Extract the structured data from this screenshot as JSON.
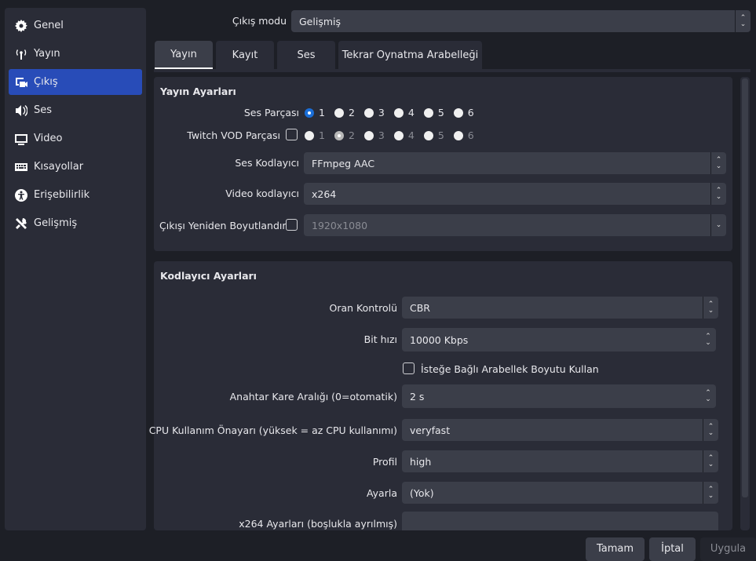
{
  "sidebar": {
    "items": [
      {
        "label": "Genel",
        "icon": "gear-icon"
      },
      {
        "label": "Yayın",
        "icon": "antenna-icon"
      },
      {
        "label": "Çıkış",
        "icon": "output-icon",
        "active": true
      },
      {
        "label": "Ses",
        "icon": "speaker-icon"
      },
      {
        "label": "Video",
        "icon": "monitor-icon"
      },
      {
        "label": "Kısayollar",
        "icon": "keyboard-icon"
      },
      {
        "label": "Erişebilirlik",
        "icon": "accessibility-icon"
      },
      {
        "label": "Gelişmiş",
        "icon": "tools-icon"
      }
    ]
  },
  "output_mode": {
    "label": "Çıkış modu",
    "value": "Gelişmiş"
  },
  "tabs": [
    {
      "label": "Yayın",
      "active": true
    },
    {
      "label": "Kayıt"
    },
    {
      "label": "Ses"
    },
    {
      "label": "Tekrar Oynatma Arabelleği"
    }
  ],
  "stream": {
    "title": "Yayın Ayarları",
    "audio_track": {
      "label": "Ses Parçası",
      "options": [
        "1",
        "2",
        "3",
        "4",
        "5",
        "6"
      ],
      "selected": "1"
    },
    "vod_track": {
      "label": "Twitch VOD Parçası",
      "checked": false,
      "options": [
        "1",
        "2",
        "3",
        "4",
        "5",
        "6"
      ],
      "selected": "2"
    },
    "audio_encoder": {
      "label": "Ses Kodlayıcı",
      "value": "FFmpeg AAC"
    },
    "video_encoder": {
      "label": "Video kodlayıcı",
      "value": "x264"
    },
    "rescale": {
      "label": "Çıkışı Yeniden Boyutlandır",
      "checked": false,
      "value": "1920x1080"
    }
  },
  "encoder": {
    "title": "Kodlayıcı Ayarları",
    "rate_control": {
      "label": "Oran Kontrolü",
      "value": "CBR"
    },
    "bitrate": {
      "label": "Bit hızı",
      "value": "10000 Kbps"
    },
    "custom_buffer": {
      "label": "İsteğe Bağlı Arabellek Boyutu Kullan",
      "checked": false
    },
    "keyframe": {
      "label": "Anahtar Kare Aralığı (0=otomatik)",
      "value": "2 s"
    },
    "preset": {
      "label": "CPU Kullanım Önayarı (yüksek = az CPU kullanımı)",
      "value": "veryfast"
    },
    "profile": {
      "label": "Profil",
      "value": "high"
    },
    "tune": {
      "label": "Ayarla",
      "value": "(Yok)"
    },
    "x264opts": {
      "label": "x264 Ayarları (boşlukla ayrılmış)",
      "value": ""
    }
  },
  "buttons": {
    "ok": "Tamam",
    "cancel": "İptal",
    "apply": "Uygula"
  },
  "colors": {
    "accent": "#284cb8",
    "radio": "#1a6ed8",
    "panel": "#2a2c37",
    "background": "#1d1f26"
  }
}
